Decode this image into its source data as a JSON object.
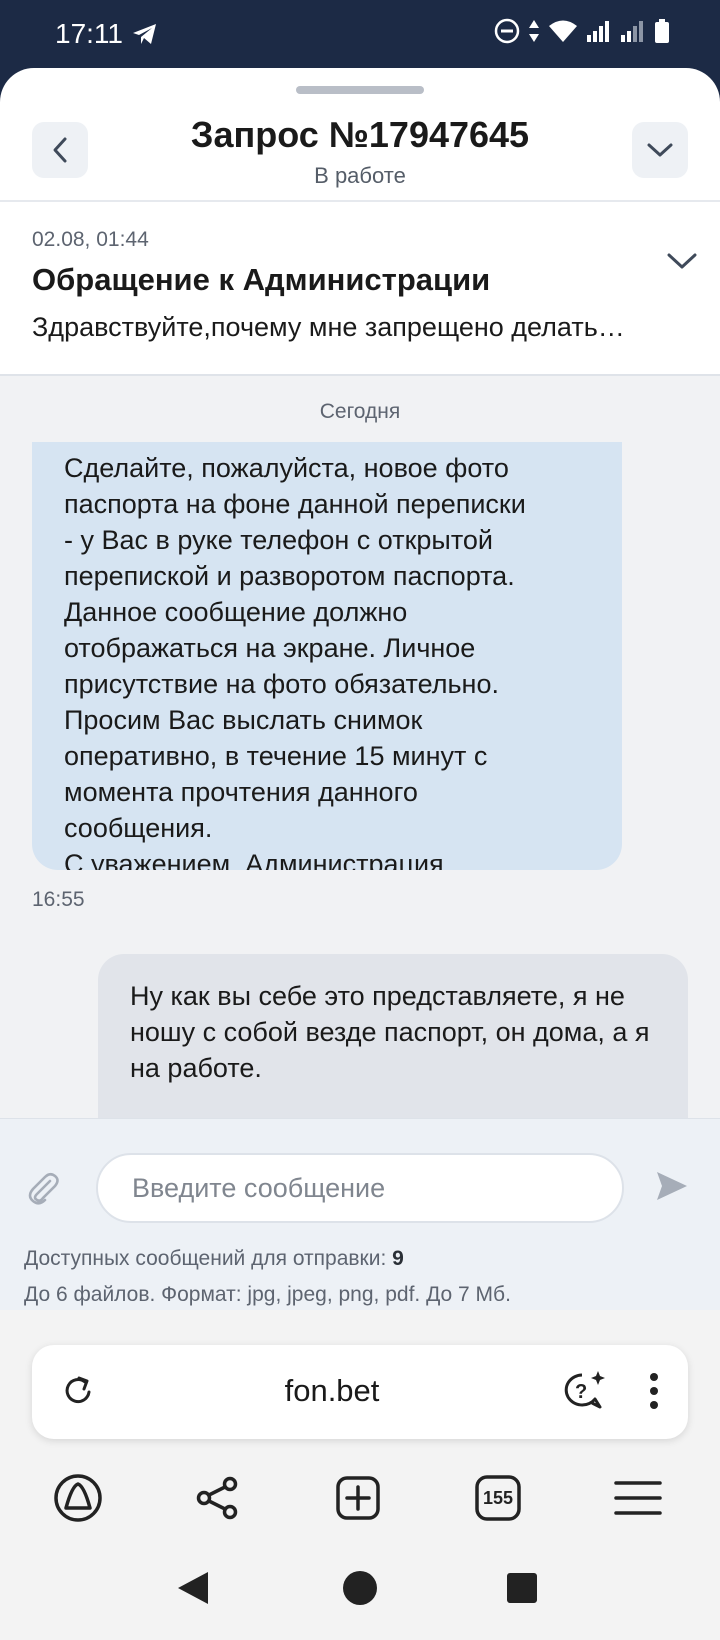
{
  "status_bar": {
    "time": "17:11"
  },
  "header": {
    "title": "Запрос №17947645",
    "status": "В работе"
  },
  "topic": {
    "date": "02.08, 01:44",
    "title": "Обращение к Администрации",
    "preview": "Здравствуйте,почему мне запрещено делать…"
  },
  "chat": {
    "day_separator": "Сегодня",
    "messages": [
      {
        "direction": "incoming",
        "text": "Сделайте, пожалуйста, новое фото\nпаспорта на фоне данной переписки\n- у Вас в руке телефон с открытой\nперепиской и разворотом паспорта.\nДанное сообщение должно\nотображаться на экране. Личное\nприсутствие на фото обязательно.\nПросим Вас выслать снимок\nоперативно, в течение 15 минут с\nмомента прочтения данного\nсообщения.\nС уважением, Администрация",
        "time": "16:55"
      },
      {
        "direction": "outgoing",
        "text": "Ну как вы себе это представляете, я не ношу с собой везде паспорт, он дома, а я на работе."
      }
    ]
  },
  "composer": {
    "placeholder": "Введите сообщение",
    "quota_label": "Доступных сообщений для отправки: ",
    "quota_value": "9",
    "limits": "До 6 файлов. Формат: jpg, jpeg, png, pdf. До 7 Мб."
  },
  "browser": {
    "url": "fon.bet",
    "tab_count": "155"
  },
  "icons": {
    "back": "chevron-left-icon",
    "collapse": "chevron-down-icon",
    "attach": "paperclip-icon",
    "send": "send-icon",
    "reload": "reload-icon",
    "assistant": "assistant-chat-icon",
    "menu": "kebab-menu-icon",
    "alice": "alice-icon",
    "share": "share-icon",
    "new_tab": "new-tab-icon",
    "tabs": "tabs-icon",
    "hamburger": "hamburger-menu-icon"
  },
  "colors": {
    "status_bar_bg": "#1c2a45",
    "incoming_bubble": "#d6e4f2",
    "outgoing_bubble": "#e1e4ea",
    "composer_bg": "#edf1f6"
  }
}
